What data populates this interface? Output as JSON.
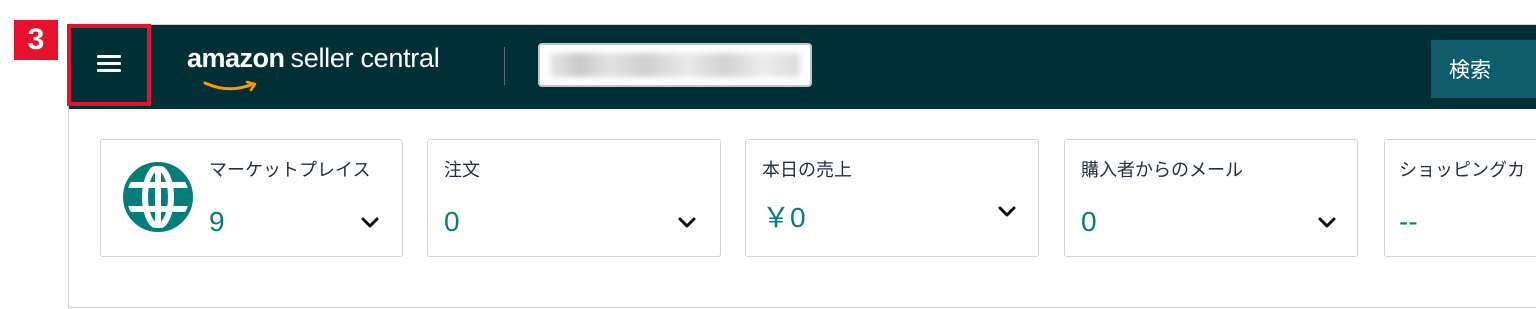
{
  "annotation": {
    "step_number": "3"
  },
  "header": {
    "logo_brand": "amazon",
    "logo_product": "seller central",
    "account_selector_value": "",
    "search_label": "検索"
  },
  "widgets": [
    {
      "label": "マーケットプレイス",
      "value": "9",
      "icon": "globe-icon"
    },
    {
      "label": "注文",
      "value": "0"
    },
    {
      "label": "本日の売上",
      "value": "￥0"
    },
    {
      "label": "購入者からのメール",
      "value": "0"
    },
    {
      "label": "ショッピングカ",
      "value": "--"
    }
  ],
  "colors": {
    "topbar": "#002f36",
    "search_button": "#0f5c6b",
    "value_teal": "#067d7d",
    "highlight_red": "#e8112d",
    "logo_smile": "#ff9900"
  }
}
